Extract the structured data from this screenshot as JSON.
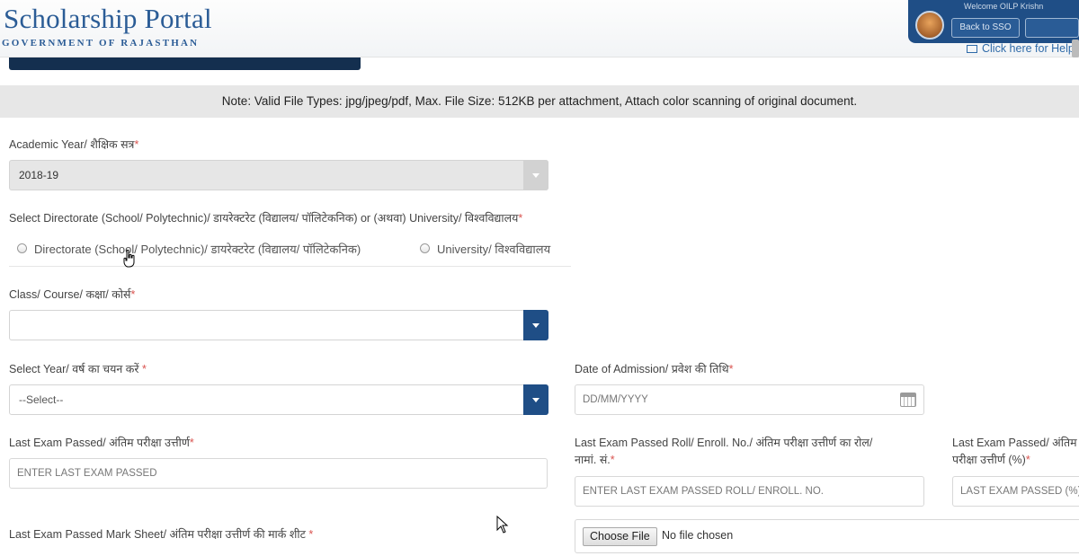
{
  "header": {
    "logo_title": "Scholarship Portal",
    "logo_subtitle": "GOVERNMENT OF RAJASTHAN",
    "welcome_text": "Welcome OILP Krishn",
    "back_button": "Back to SSO",
    "help_link": "Click here for Help"
  },
  "note": "Note: Valid File Types: jpg/jpeg/pdf, Max. File Size: 512KB per attachment, Attach color scanning of original document.",
  "form": {
    "academic_year": {
      "label": "Academic Year/ शैक्षिक सत्र",
      "value": "2018-19"
    },
    "directorate": {
      "label": "Select Directorate (School/ Polytechnic)/ डायरेक्टरेट (विद्यालय/ पॉलिटेकनिक) or (अथवा) University/ विश्वविद्यालय",
      "options": [
        "Directorate (School/ Polytechnic)/ डायरेक्टरेट (विद्यालय/ पॉलिटेकनिक)",
        "University/ विश्वविद्यालय"
      ]
    },
    "class_course": {
      "label": "Class/ Course/ कक्षा/ कोर्स",
      "value": ""
    },
    "select_year": {
      "label": "Select Year/ वर्ष का चयन करें",
      "value": "--Select--"
    },
    "date_of_admission": {
      "label": "Date of Admission/ प्रवेश की तिथि",
      "placeholder": "DD/MM/YYYY"
    },
    "last_exam_passed": {
      "label": "Last Exam Passed/ अंतिम परीक्षा उत्तीर्ण",
      "placeholder": "ENTER LAST EXAM PASSED"
    },
    "roll_no": {
      "label_line1": "Last Exam Passed Roll/ Enroll. No./ अंतिम परीक्षा उत्तीर्ण का रोल/",
      "label_line2": "नामां. सं.",
      "placeholder": "ENTER LAST EXAM PASSED ROLL/ ENROLL. NO."
    },
    "percentage": {
      "label_line1": "Last Exam Passed/ अंतिम",
      "label_line2": "परीक्षा उत्तीर्ण (%)",
      "placeholder": "LAST EXAM PASSED (%)"
    },
    "mark_sheet": {
      "label": "Last Exam Passed Mark Sheet/ अंतिम परीक्षा उत्तीर्ण की मार्क शीट",
      "button": "Choose File",
      "status": "No file chosen"
    },
    "required_mark": "*"
  },
  "colors": {
    "brand_blue": "#1f4e86",
    "required": "#d9534f"
  }
}
